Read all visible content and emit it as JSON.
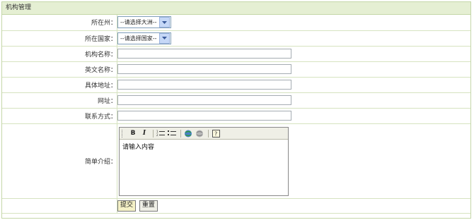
{
  "panel": {
    "title": "机构管理"
  },
  "form": {
    "continent": {
      "label": "所在州：",
      "selected": "--请选择大洲--"
    },
    "country": {
      "label": "所在国家：",
      "selected": "--请选择国家--"
    },
    "name_cn": {
      "label": "机构名称：",
      "value": ""
    },
    "name_en": {
      "label": "英文名称：",
      "value": ""
    },
    "address": {
      "label": "具体地址：",
      "value": ""
    },
    "website": {
      "label": "网址：",
      "value": ""
    },
    "contact": {
      "label": "联系方式：",
      "value": ""
    },
    "intro": {
      "label": "简单介绍：",
      "placeholder": "请输入内容",
      "toolbar": [
        "bold-icon",
        "italic-icon",
        "ordered-list-icon",
        "unordered-list-icon",
        "insert-link-icon",
        "unlink-icon",
        "help-icon"
      ]
    }
  },
  "buttons": {
    "submit": "提交",
    "reset": "重置"
  },
  "colors": {
    "header_bg": "#e5efd3",
    "border": "#c4d7a8",
    "submit_bg": "#f5f1c6"
  }
}
